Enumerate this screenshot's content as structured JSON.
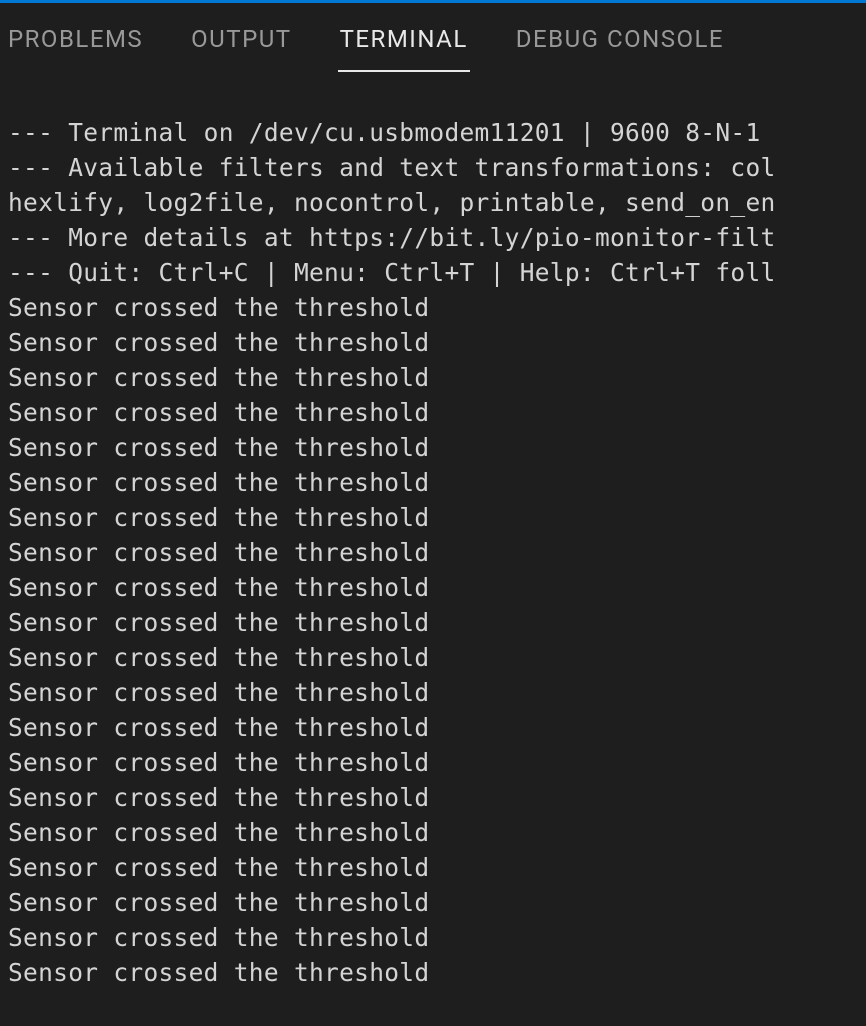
{
  "tabs": {
    "problems": "PROBLEMS",
    "output": "OUTPUT",
    "terminal": "TERMINAL",
    "debugConsole": "DEBUG CONSOLE",
    "active": "terminal"
  },
  "terminal": {
    "lines": [
      "--- Terminal on /dev/cu.usbmodem11201 | 9600 8-N-1 ",
      "--- Available filters and text transformations: col",
      "hexlify, log2file, nocontrol, printable, send_on_en",
      "--- More details at https://bit.ly/pio-monitor-filt",
      "--- Quit: Ctrl+C | Menu: Ctrl+T | Help: Ctrl+T foll",
      "Sensor crossed the threshold",
      "Sensor crossed the threshold",
      "Sensor crossed the threshold",
      "Sensor crossed the threshold",
      "Sensor crossed the threshold",
      "Sensor crossed the threshold",
      "Sensor crossed the threshold",
      "Sensor crossed the threshold",
      "Sensor crossed the threshold",
      "Sensor crossed the threshold",
      "Sensor crossed the threshold",
      "Sensor crossed the threshold",
      "Sensor crossed the threshold",
      "Sensor crossed the threshold",
      "Sensor crossed the threshold",
      "Sensor crossed the threshold",
      "Sensor crossed the threshold",
      "Sensor crossed the threshold",
      "Sensor crossed the threshold",
      "Sensor crossed the threshold"
    ]
  }
}
